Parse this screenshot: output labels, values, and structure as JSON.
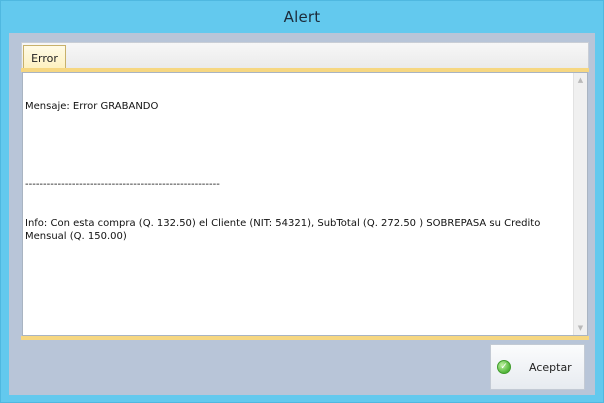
{
  "window": {
    "title": "Alert"
  },
  "tabs": [
    {
      "label": "Error",
      "selected": true
    }
  ],
  "message": {
    "lines": [
      "Mensaje: Error GRABANDO",
      "",
      "------------------------------------------------------",
      "Info: Con esta compra (Q. 132.50) el Cliente (NIT: 54321), SubTotal (Q. 272.50 ) SOBREPASA su Credito Mensual (Q. 150.00)"
    ]
  },
  "scrollbar": {
    "up_icon": "triangle-up",
    "down_icon": "triangle-down"
  },
  "buttons": {
    "accept_label": "Aceptar",
    "accept_icon": "check-circle-icon"
  },
  "colors": {
    "titlebar": "#63c9ee",
    "client_background": "#b8c5d8",
    "tab_accent": "#f6d781",
    "accept_icon": "#52b53a"
  }
}
